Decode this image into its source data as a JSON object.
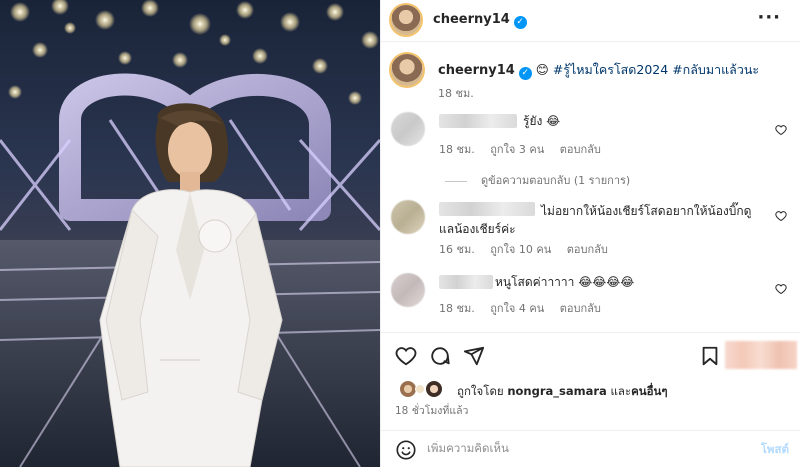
{
  "post": {
    "username": "cheerny14",
    "verified_glyph": "✓",
    "more_label": "···",
    "caption": {
      "username": "cheerny14",
      "emoji": "😊",
      "hashtag1": "#รู้ไหมใครโสด2024",
      "hashtag2": "#กลับมาแล้วนะ",
      "time": "18 ชม."
    }
  },
  "comments": [
    {
      "text": "รู้ยัง 😂",
      "time": "18 ชม.",
      "likes": "ถูกใจ 3 คน",
      "reply_label": "ตอบกลับ",
      "avatar_colors": [
        "#d9d9d9",
        "#c9c9c9",
        "#e6e6e6",
        "#bdbdbd"
      ]
    },
    {
      "text": "ไม่อยากให้น้องเชียร์โสดอยากให้น้องบิ๊กดูแลน้องเชียร์ค่ะ",
      "time": "16 ชม.",
      "likes": "ถูกใจ 10 คน",
      "reply_label": "ตอบกลับ",
      "avatar_colors": [
        "#cfc6ad",
        "#b9af93",
        "#ddd4bd",
        "#c4bba1"
      ]
    },
    {
      "text": "หนูโสดค่าาาาา 😂😂😂😂",
      "time": "18 ชม.",
      "likes": "ถูกใจ 4 คน",
      "reply_label": "ตอบกลับ",
      "avatar_colors": [
        "#d8cfcf",
        "#c4b9b9",
        "#e3dada",
        "#cbbfbf"
      ]
    }
  ],
  "view_replies": "ดูข้อความตอบกลับ (1 รายการ)",
  "likes_summary": {
    "prefix": "ถูกใจโดย",
    "user": "nongra_samara",
    "connector": "และ",
    "others": "คนอื่นๆ"
  },
  "time_ago": "18 ชั่วโมงที่แล้ว",
  "add_comment": {
    "placeholder": "เพิ่มความคิดเห็น",
    "post_label": "โพสต์"
  },
  "icons": {
    "like": "heart-icon",
    "comment": "comment-icon",
    "share": "send-icon",
    "save": "bookmark-icon",
    "emoji": "emoji-icon"
  },
  "colors": {
    "link": "#00376b",
    "verified": "#0095f6",
    "muted": "#737373",
    "post_button": "#b3dbff"
  }
}
